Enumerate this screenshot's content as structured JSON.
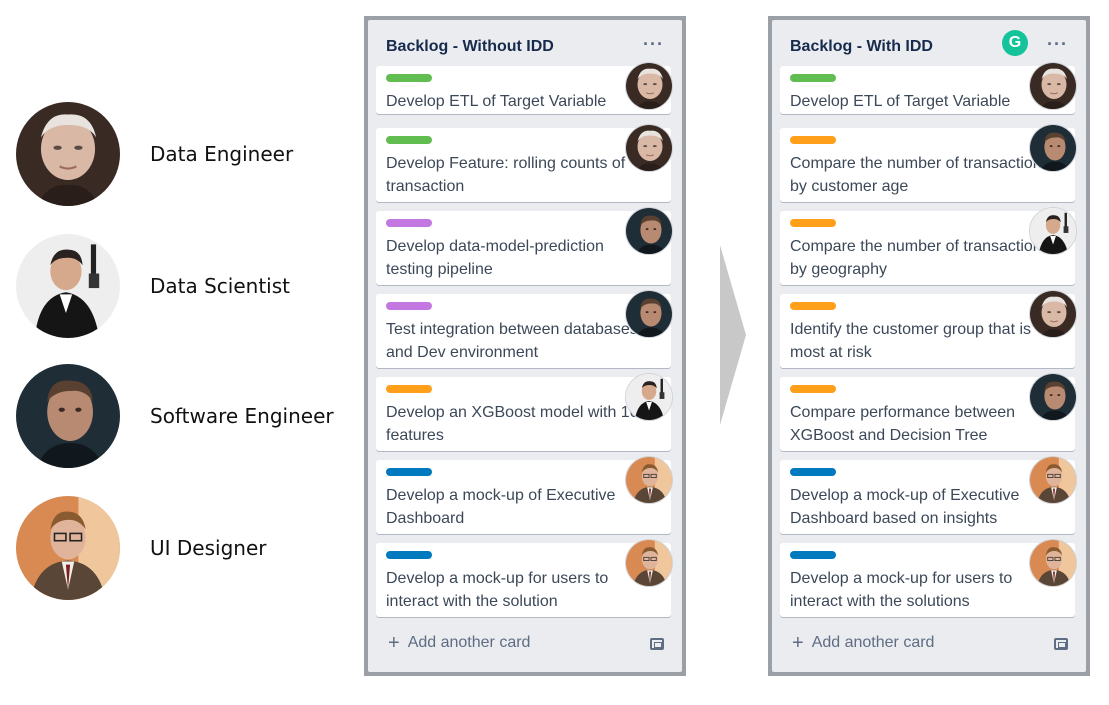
{
  "roles": [
    {
      "label": "Data Engineer",
      "avatar": "data-engineer"
    },
    {
      "label": "Data Scientist",
      "avatar": "data-scientist"
    },
    {
      "label": "Software Engineer",
      "avatar": "software-engineer"
    },
    {
      "label": "UI Designer",
      "avatar": "ui-designer"
    }
  ],
  "colors": {
    "green": "#61bd4f",
    "purple": "#c377e0",
    "orange": "#ff9f1a",
    "blue": "#0079bf",
    "grammarly": "#15c39a",
    "board_frame": "#9aa0a6",
    "list_bg": "#ebecf0"
  },
  "board_left": {
    "title": "Backlog - Without IDD",
    "menu": "···",
    "add_card": "Add another card",
    "cards": [
      {
        "label_color": "green",
        "title": "Develop ETL of Target Variable",
        "member": "data-engineer"
      },
      {
        "label_color": "green",
        "title": "Develop Feature: rolling counts of\ntransaction",
        "member": "data-engineer"
      },
      {
        "label_color": "purple",
        "title": "Develop data-model-prediction\ntesting pipeline",
        "member": "software-engineer"
      },
      {
        "label_color": "purple",
        "title": "Test integration between databases\nand Dev environment",
        "member": "software-engineer"
      },
      {
        "label_color": "orange",
        "title": "Develop an XGBoost model with 10\nfeatures",
        "member": "data-scientist"
      },
      {
        "label_color": "blue",
        "title": "Develop a mock-up of Executive\nDashboard",
        "member": "ui-designer"
      },
      {
        "label_color": "blue",
        "title": "Develop a mock-up for users to\ninteract with the solution",
        "member": "ui-designer"
      }
    ]
  },
  "board_right": {
    "title": "Backlog - With IDD",
    "menu": "···",
    "grammarly": "G",
    "add_card": "Add another card",
    "cards": [
      {
        "label_color": "green",
        "title": "Develop ETL of Target Variable",
        "member": "data-engineer"
      },
      {
        "label_color": "orange",
        "title": "Compare the number of transaction\nby customer age",
        "member": "software-engineer"
      },
      {
        "label_color": "orange",
        "title": "Compare the number of transaction\nby geography",
        "member": "data-scientist"
      },
      {
        "label_color": "orange",
        "title": "Identify the customer group that is\nmost at risk",
        "member": "data-engineer"
      },
      {
        "label_color": "orange",
        "title": "Compare performance between\nXGBoost and Decision Tree",
        "member": "software-engineer"
      },
      {
        "label_color": "blue",
        "title": "Develop a mock-up of Executive\nDashboard based on insights",
        "member": "ui-designer"
      },
      {
        "label_color": "blue",
        "title": "Develop a mock-up for users to\ninteract with the solutions",
        "member": "ui-designer"
      }
    ]
  }
}
